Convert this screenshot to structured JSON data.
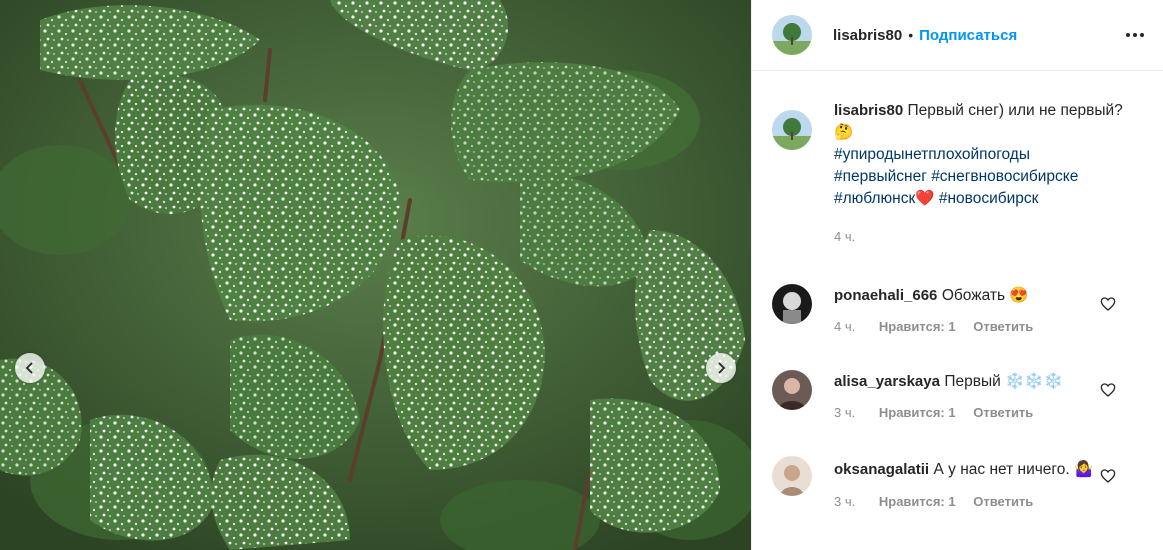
{
  "header": {
    "username": "lisabris80",
    "separator": "•",
    "follow_label": "Подписаться",
    "more_icon": "more-dots-icon"
  },
  "caption": {
    "username": "lisabris80",
    "text": "Первый снег) или не первый? 🤔",
    "hashtags": [
      "#упиродынетплохойпогоды",
      "#первыйснег",
      "#снегвновосибирске",
      "#люблюнск❤️",
      "#новосибирск"
    ],
    "time": "4 ч."
  },
  "comments": [
    {
      "username": "ponaehali_666",
      "text": "Обожать 😍",
      "time": "4 ч.",
      "likes": "Нравится: 1",
      "reply": "Ответить"
    },
    {
      "username": "alisa_yarskaya",
      "text": "Первый ❄️❄️❄️",
      "time": "3 ч.",
      "likes": "Нравится: 1",
      "reply": "Ответить"
    },
    {
      "username": "oksanagalatii",
      "text": "А у нас нет ничего. 🤷‍♀️",
      "time": "3 ч.",
      "likes": "Нравится: 1",
      "reply": "Ответить"
    }
  ],
  "photo": {
    "prev_icon": "chevron-left-icon",
    "next_icon": "chevron-right-icon"
  },
  "colors": {
    "accent": "#0095f6",
    "hashtag": "#00376b",
    "muted": "#8e8e8e",
    "leaf": "#4a7a3e",
    "snow": "#f2f5f2"
  }
}
